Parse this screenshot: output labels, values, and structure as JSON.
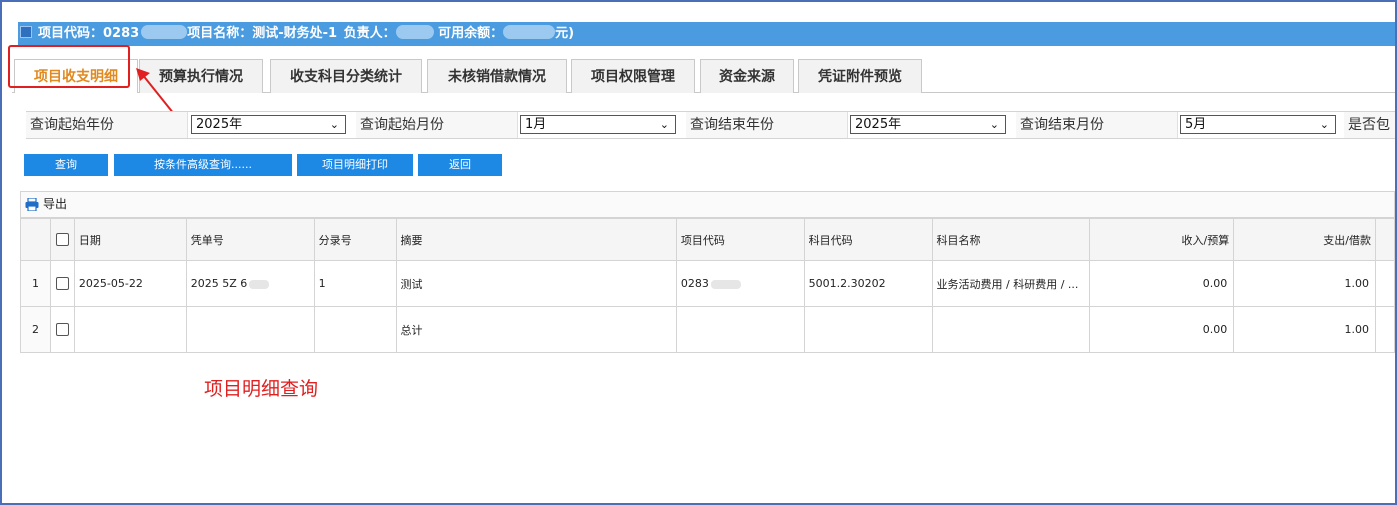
{
  "header": {
    "project_code_label": "项目代码：",
    "project_code": "0283",
    "project_name_label": "项目名称：",
    "project_name": "测试-财务处-1",
    "owner_label": "负责人：",
    "balance_label": "可用余额：",
    "balance_suffix": "元)"
  },
  "tabs": [
    {
      "label": "项目收支明细"
    },
    {
      "label": "预算执行情况"
    },
    {
      "label": "收支科目分类统计"
    },
    {
      "label": "未核销借款情况"
    },
    {
      "label": "项目权限管理"
    },
    {
      "label": "资金来源"
    },
    {
      "label": "凭证附件预览"
    }
  ],
  "filters": {
    "start_year_label": "查询起始年份",
    "start_year": "2025年",
    "start_month_label": "查询起始月份",
    "start_month": "1月",
    "end_year_label": "查询结束年份",
    "end_year": "2025年",
    "end_month_label": "查询结束月份",
    "end_month": "5月",
    "include_label": "是否包"
  },
  "buttons": {
    "query": "查询",
    "advanced": "按条件高级查询......",
    "print": "项目明细打印",
    "back": "返回"
  },
  "toolbar": {
    "export_label": "导出"
  },
  "table": {
    "headers": {
      "date": "日期",
      "voucher": "凭单号",
      "entry": "分录号",
      "summary": "摘要",
      "project_code": "项目代码",
      "subject_code": "科目代码",
      "subject_name": "科目名称",
      "income": "收入/预算",
      "expense": "支出/借款"
    },
    "rows": [
      {
        "index": "1",
        "date": "2025-05-22",
        "voucher": "2025 5Z  6",
        "entry": "1",
        "summary": "测试",
        "project_code": "0283",
        "subject_code": "5001.2.30202",
        "subject_name": "业务活动费用 / 科研费用 / ...",
        "income": "0.00",
        "expense": "1.00"
      },
      {
        "index": "2",
        "date": "",
        "voucher": "",
        "entry": "",
        "summary": "总计",
        "project_code": "",
        "subject_code": "",
        "subject_name": "",
        "income": "0.00",
        "expense": "1.00"
      }
    ]
  },
  "annotation": {
    "text": "项目明细查询",
    "color": "#e02020"
  },
  "colors": {
    "accent": "#1e88e5",
    "titlebar": "#4a9be0",
    "active_tab": "#e08a1f"
  }
}
